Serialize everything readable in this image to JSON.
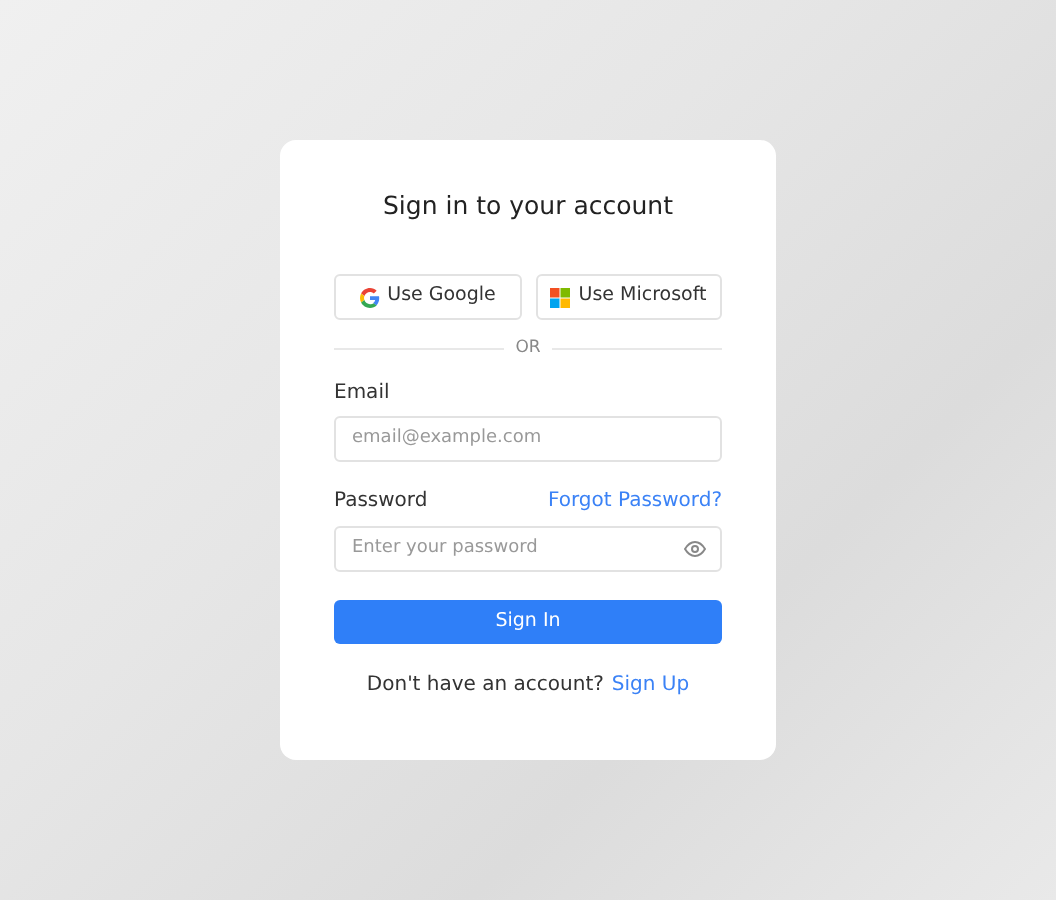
{
  "title": "Sign in to your account",
  "social_buttons": [
    {
      "kind": "google",
      "label": "Use Google"
    },
    {
      "kind": "microsoft",
      "label": "Use Microsoft"
    }
  ],
  "divider": "OR",
  "email": {
    "label": "Email",
    "placeholder": "email@example.com"
  },
  "password": {
    "label": "Password",
    "forgot": "Forgot Password?",
    "placeholder": "Enter your password"
  },
  "submit": "Sign In",
  "footer": {
    "text": "Don't have an account?",
    "link": "Sign Up"
  }
}
